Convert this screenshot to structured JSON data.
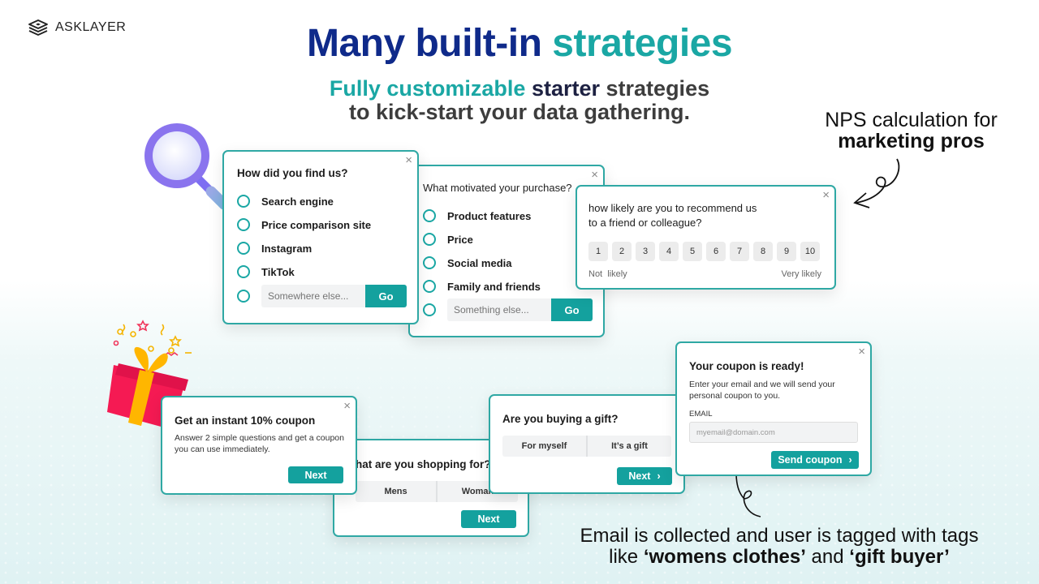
{
  "brand": {
    "logo_text": "ASKLAYER",
    "icon": "layers-icon"
  },
  "hero": {
    "title_part1": "Many built-in",
    "title_part2": "strategies",
    "subtitle_teal": "Fully customizable",
    "subtitle_navy": "starter",
    "subtitle_rest1": "strategies",
    "subtitle_line2": "to kick-start your data gathering."
  },
  "colors": {
    "teal": "#1aa7a4",
    "navy": "#0f2a8a",
    "button": "#14a19e"
  },
  "annotations": {
    "nps_line1": "NPS calculation for",
    "nps_line2": "marketing pros",
    "email_line1": "Email is collected and user is tagged with tags",
    "email_like": "like ",
    "email_tag1": "‘womens clothes’",
    "email_and": " and ",
    "email_tag2": "‘gift buyer’"
  },
  "find_us": {
    "question": "How did you find us?",
    "options": [
      "Search engine",
      "Price comparison site",
      "Instagram",
      "TikTok"
    ],
    "other_placeholder": "Somewhere else...",
    "go_label": "Go"
  },
  "motivated": {
    "question": "What motivated your purchase?",
    "options": [
      "Product features",
      "Price",
      "Social media",
      "Family and friends"
    ],
    "other_placeholder": "Something else...",
    "go_label": "Go"
  },
  "nps": {
    "question_line1": "how likely are you to recommend us",
    "question_line2": "to a friend or colleague?",
    "scale": [
      "1",
      "2",
      "3",
      "4",
      "5",
      "6",
      "7",
      "8",
      "9",
      "10"
    ],
    "low_label": "Not  likely",
    "high_label": "Very likely"
  },
  "coupon_offer": {
    "title": "Get an instant 10% coupon",
    "body_line1": "Answer 2 simple questions and get a coupon",
    "body_line2": "you can use immediately.",
    "next_label": "Next"
  },
  "shopping_for": {
    "question": "hat are you shopping for?",
    "options": [
      "Mens",
      "Woman"
    ],
    "next_label": "Next"
  },
  "gift": {
    "question": "Are you buying a gift?",
    "options": [
      "For myself",
      "It’s a gift"
    ],
    "next_label": "Next",
    "next_icon": "›"
  },
  "coupon_ready": {
    "title": "Your coupon is ready!",
    "body_line1": "Enter your email and we will send your",
    "body_line2": "personal coupon to you.",
    "email_label": "EMAIL",
    "email_placeholder": "myemail@domain.com",
    "send_label": "Send coupon",
    "send_icon": "›"
  },
  "close_icon": "×"
}
